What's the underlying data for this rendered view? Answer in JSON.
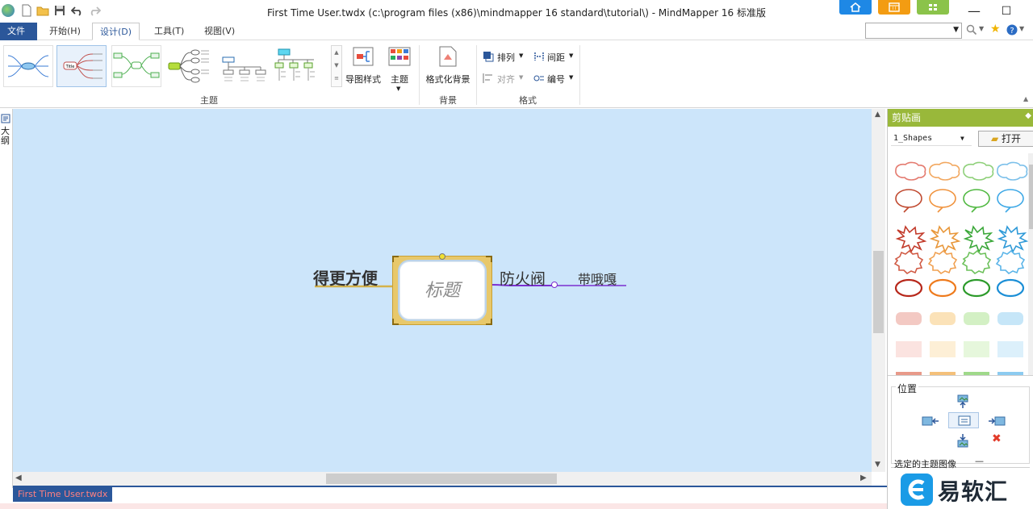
{
  "window": {
    "title": "First Time User.twdx (c:\\program files (x86)\\mindmapper 16 standard\\tutorial\\) - MindMapper 16 标准版",
    "min_glyph": "—",
    "max_glyph": "☐"
  },
  "menu": {
    "file": "文件(F)",
    "tabs": [
      "开始(H)",
      "设计(D)",
      "工具(T)",
      "视图(V)"
    ]
  },
  "ribbon": {
    "group_theme": "主题",
    "group_background": "背景",
    "group_format": "格式",
    "map_style": "导图样式",
    "theme": "主题",
    "format_background": "格式化背景",
    "arrange": "排列",
    "align": "对齐",
    "spacing": "间距",
    "numbering": "编号",
    "gallery_title": "Title"
  },
  "left_panel": {
    "label": "大纲"
  },
  "map": {
    "central": "标题",
    "left_topic": "得更方便",
    "right_topic": "防火阀",
    "right_subtopic": "带哦嘎"
  },
  "doc_tab": "First Time User.twdx",
  "right_panel": {
    "header": "剪贴画",
    "library": "1_Shapes",
    "open_button": "打开",
    "position_label": "位置",
    "bottom_label": "选定的主题图像"
  },
  "watermark": "易软汇",
  "colors": {
    "accent": "#2b579a",
    "canvas": "#cce5fa",
    "panel_header": "#99b83a",
    "topic_line_left": "#d4b24a",
    "topic_line_right": "#7b2fd0"
  }
}
